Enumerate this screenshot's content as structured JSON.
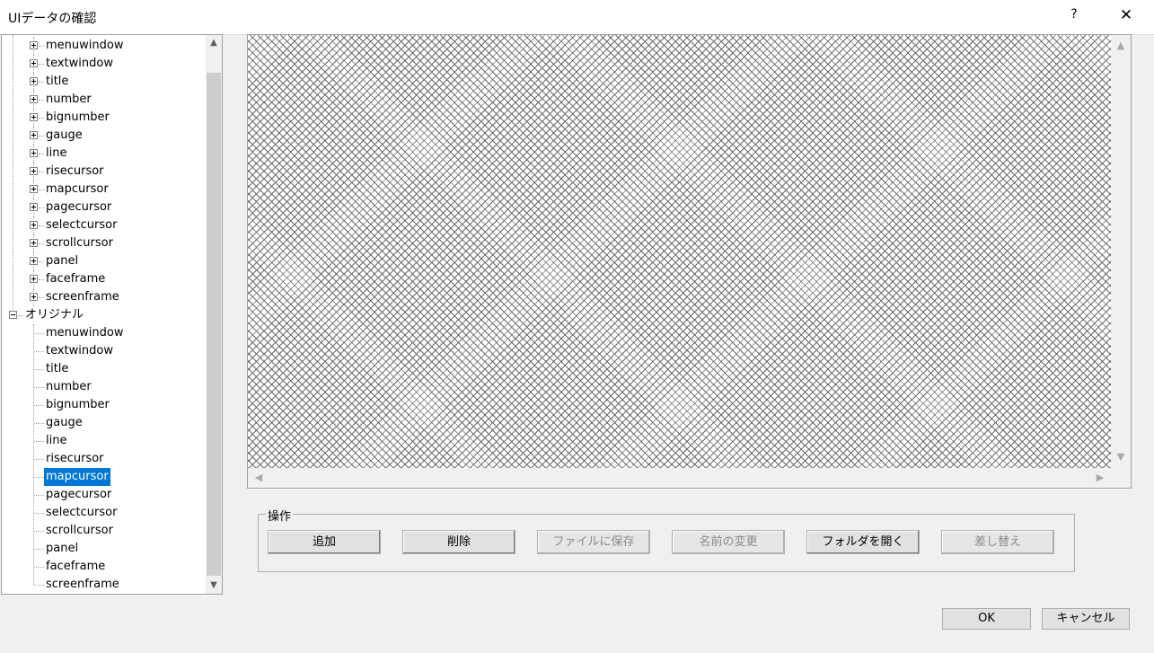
{
  "window": {
    "title": "UIデータの確認",
    "help": "?",
    "close": "✕"
  },
  "tree": {
    "group1_items": [
      "menuwindow",
      "textwindow",
      "title",
      "number",
      "bignumber",
      "gauge",
      "line",
      "risecursor",
      "mapcursor",
      "pagecursor",
      "selectcursor",
      "scrollcursor",
      "panel",
      "faceframe",
      "screenframe"
    ],
    "group2_label": "オリジナル",
    "group2_items": [
      "menuwindow",
      "textwindow",
      "title",
      "number",
      "bignumber",
      "gauge",
      "line",
      "risecursor",
      "mapcursor",
      "pagecursor",
      "selectcursor",
      "scrollcursor",
      "panel",
      "faceframe",
      "screenframe"
    ],
    "selected": "mapcursor",
    "scroll_up": "▲",
    "scroll_down": "▼"
  },
  "preview": {
    "scroll_up": "▲",
    "scroll_down": "▼",
    "scroll_left": "◀",
    "scroll_right": "▶"
  },
  "operations": {
    "label": "操作",
    "add": "追加",
    "delete": "削除",
    "save_file": "ファイルに保存",
    "rename": "名前の変更",
    "open_folder": "フォルダを開く",
    "replace": "差し替え"
  },
  "dialog": {
    "ok": "OK",
    "cancel": "キャンセル"
  }
}
